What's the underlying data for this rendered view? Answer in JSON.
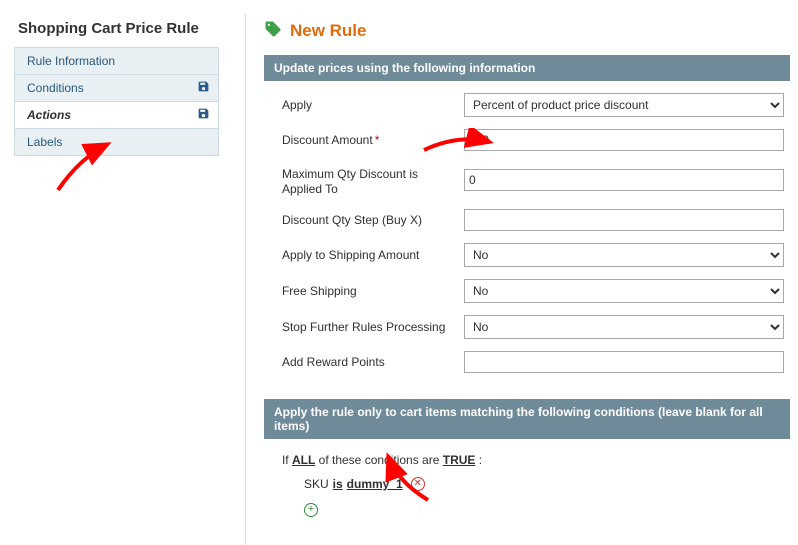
{
  "sidebar": {
    "title": "Shopping Cart Price Rule",
    "tabs": [
      {
        "label": "Rule Information",
        "saveIcon": false
      },
      {
        "label": "Conditions",
        "saveIcon": true
      },
      {
        "label": "Actions",
        "saveIcon": true
      },
      {
        "label": "Labels",
        "saveIcon": false
      }
    ],
    "activeIndex": 2
  },
  "page": {
    "title": "New Rule"
  },
  "panel1": {
    "title": "Update prices using the following information",
    "apply": {
      "label": "Apply",
      "selected": "Percent of product price discount"
    },
    "discountAmount": {
      "label": "Discount Amount",
      "required": true,
      "value": "100"
    },
    "maxQty": {
      "label": "Maximum Qty Discount is Applied To",
      "value": "0"
    },
    "qtyStep": {
      "label": "Discount Qty Step (Buy X)",
      "value": ""
    },
    "applyShipping": {
      "label": "Apply to Shipping Amount",
      "selected": "No"
    },
    "freeShipping": {
      "label": "Free Shipping",
      "selected": "No"
    },
    "stopRules": {
      "label": "Stop Further Rules Processing",
      "selected": "No"
    },
    "rewardPoints": {
      "label": "Add Reward Points",
      "value": ""
    }
  },
  "panel2": {
    "title": "Apply the rule only to cart items matching the following conditions (leave blank for all items)",
    "sentence": {
      "prefix": "If",
      "aggregator": "ALL",
      "mid": "of these conditions are",
      "bool": "TRUE",
      "suffix": ":"
    },
    "rule": {
      "attribute": "SKU",
      "operator": "is",
      "value": "dummy_1"
    }
  }
}
